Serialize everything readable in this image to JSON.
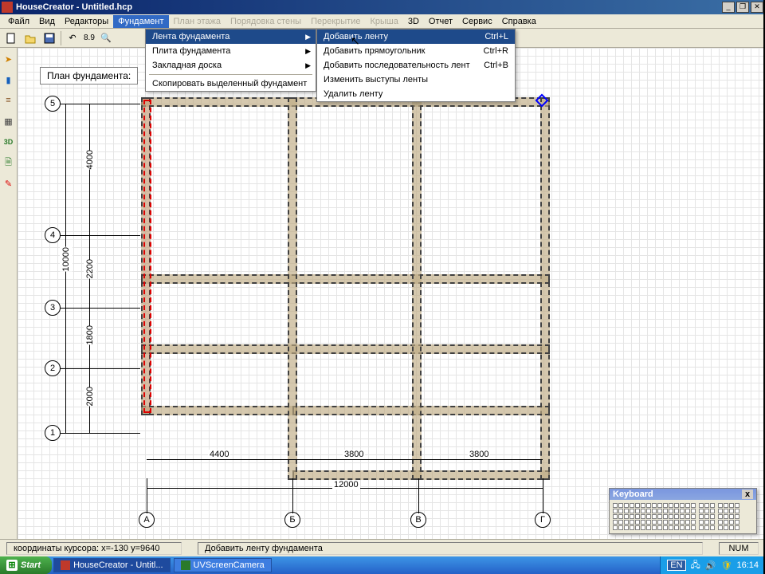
{
  "window": {
    "title": "HouseCreator - Untitled.hcp"
  },
  "menubar": {
    "file": "Файл",
    "view": "Вид",
    "editors": "Редакторы",
    "foundation": "Фундамент",
    "floorplan": "План этажа",
    "wallorder": "Порядовка стены",
    "slab": "Перекрытие",
    "roof": "Крыша",
    "td": "3D",
    "report": "Отчет",
    "service": "Сервис",
    "help": "Справка"
  },
  "toolbar": {
    "scale": "8.9"
  },
  "plan_label": "План фундамента:",
  "dropdown": {
    "strip_foundation": "Лента фундамента",
    "slab_foundation": "Плита фундамента",
    "mortgage_board": "Закладная доска",
    "copy_selected": "Скопировать выделенный фундамент"
  },
  "submenu": {
    "add_strip": "Добавить ленту",
    "add_strip_sc": "Ctrl+L",
    "add_rect": "Добавить прямоугольник",
    "add_rect_sc": "Ctrl+R",
    "add_seq": "Добавить последовательность лент",
    "add_seq_sc": "Ctrl+B",
    "edit_ledges": "Изменить выступы ленты",
    "delete_strip": "Удалить ленту"
  },
  "dimensions": {
    "v1": "4000",
    "v2": "2200",
    "v3": "1800",
    "v4": "2000",
    "v_total": "10000",
    "h1": "4400",
    "h2": "3800",
    "h3": "3800",
    "h_total": "12000"
  },
  "axes": {
    "num1": "1",
    "num2": "2",
    "num3": "3",
    "num4": "4",
    "num5": "5",
    "letA": "А",
    "letB": "Б",
    "letC": "В",
    "letD": "Г"
  },
  "status": {
    "coords": "координаты курсора: х=-130 y=9640",
    "action": "Добавить ленту фундамента",
    "num": "NUM"
  },
  "taskbar": {
    "start": "Start",
    "app1": "HouseCreator - Untitl...",
    "app2": "UVScreenCamera",
    "lang": "EN",
    "time": "16:14"
  },
  "keyboard_float": {
    "title": "Keyboard",
    "close": "x"
  }
}
